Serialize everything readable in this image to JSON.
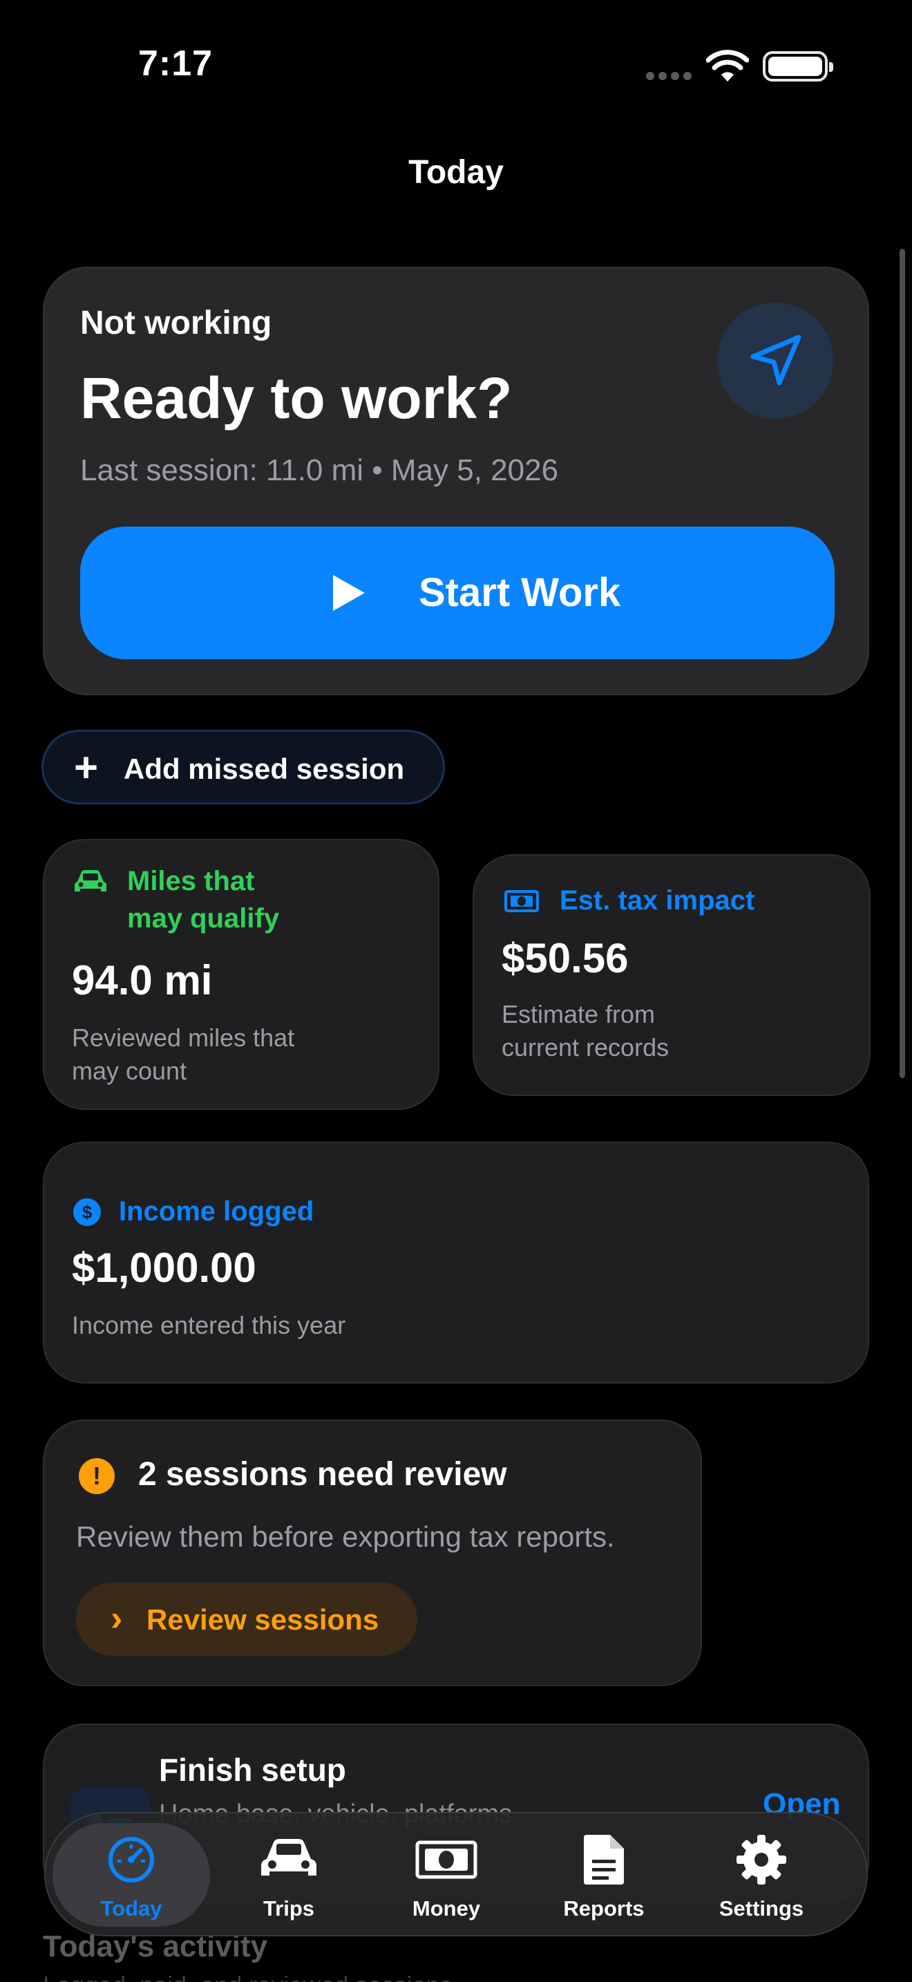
{
  "status_bar": {
    "time": "7:17"
  },
  "nav": {
    "title": "Today"
  },
  "hero": {
    "status": "Not working",
    "title": "Ready to work?",
    "subtitle": "Last session: 11.0 mi • May 5, 2026",
    "start_label": "Start Work"
  },
  "add_missed": {
    "label": "Add missed session"
  },
  "miles": {
    "label_line1": "Miles that",
    "label_line2": "may qualify",
    "value": "94.0 mi",
    "note_line1": "Reviewed miles that",
    "note_line2": "may count"
  },
  "tax": {
    "label": "Est. tax impact",
    "value": "$50.56",
    "note_line1": "Estimate from",
    "note_line2": "current records"
  },
  "income": {
    "label": "Income logged",
    "value": "$1,000.00",
    "note": "Income entered this year"
  },
  "review": {
    "title": "2 sessions need review",
    "subtitle": "Review them before exporting tax reports.",
    "button_label": "Review sessions"
  },
  "setup": {
    "title": "Finish setup",
    "subtitle": "Home base, vehicle, platforms",
    "open_label": "Open"
  },
  "activity": {
    "title": "Today's activity",
    "subtitle": "Logged, paid, and reviewed sessions"
  },
  "tabs": [
    {
      "label": "Today",
      "icon": "speedometer-icon",
      "active": true
    },
    {
      "label": "Trips",
      "icon": "car-icon",
      "active": false
    },
    {
      "label": "Money",
      "icon": "banknote-icon",
      "active": false
    },
    {
      "label": "Reports",
      "icon": "document-icon",
      "active": false
    },
    {
      "label": "Settings",
      "icon": "gear-icon",
      "active": false
    }
  ],
  "colors": {
    "accent": "#0a84ff",
    "green": "#30d158",
    "orange": "#ff9f0a",
    "card": "#1f1f21"
  }
}
